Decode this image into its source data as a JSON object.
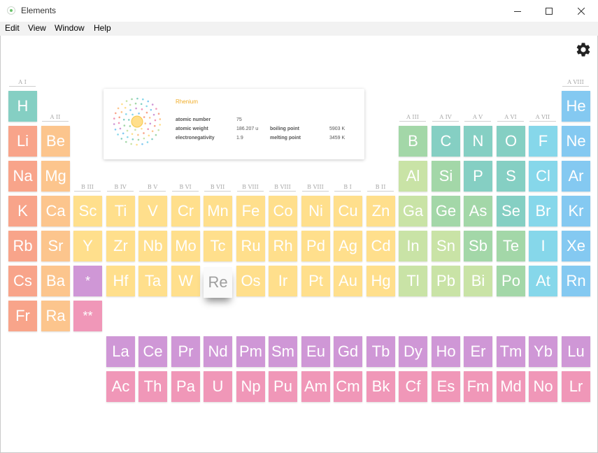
{
  "window": {
    "title": "Elements"
  },
  "menu": [
    "Edit",
    "View",
    "Window",
    "Help"
  ],
  "colors": {
    "alkali": "#f8a48a",
    "alkaline": "#fcc58d",
    "transition": "#ffdf8c",
    "post": "#c9e3a6",
    "metalloid": "#a3d7a8",
    "nonmetal": "#85cfc3",
    "halogen": "#86d7ea",
    "noble": "#84c9f1",
    "lanthanide": "#cf97d6",
    "actinide": "#f097b8",
    "accent": "#f0ad28",
    "highlight": "#cf97d6"
  },
  "groups": [
    "A I",
    "A II",
    "B III",
    "B IV",
    "B V",
    "B VI",
    "B VII",
    "B VIII",
    "B VIII",
    "B VIII",
    "B I",
    "B II",
    "A III",
    "A IV",
    "A V",
    "A VI",
    "A VII",
    "A VIII"
  ],
  "info": {
    "name": "Rhenium",
    "atomic_number_label": "atomic number",
    "atomic_number": "75",
    "atomic_weight_label": "atomic weight",
    "atomic_weight": "186.207 u",
    "electronegativity_label": "electronegativity",
    "electronegativity": "1.9",
    "boiling_point_label": "boiling point",
    "boiling_point": "5903 K",
    "melting_point_label": "melting point",
    "melting_point": "3459 K"
  },
  "hovered": "Re",
  "elements": [
    {
      "s": "H",
      "c": "nonmetal",
      "r": 0,
      "col": 0
    },
    {
      "s": "He",
      "c": "noble",
      "r": 0,
      "col": 17
    },
    {
      "s": "Li",
      "c": "alkali",
      "r": 1,
      "col": 0
    },
    {
      "s": "Be",
      "c": "alkaline",
      "r": 1,
      "col": 1
    },
    {
      "s": "B",
      "c": "metalloid",
      "r": 1,
      "col": 12
    },
    {
      "s": "C",
      "c": "nonmetal",
      "r": 1,
      "col": 13
    },
    {
      "s": "N",
      "c": "nonmetal",
      "r": 1,
      "col": 14
    },
    {
      "s": "O",
      "c": "nonmetal",
      "r": 1,
      "col": 15
    },
    {
      "s": "F",
      "c": "halogen",
      "r": 1,
      "col": 16
    },
    {
      "s": "Ne",
      "c": "noble",
      "r": 1,
      "col": 17
    },
    {
      "s": "Na",
      "c": "alkali",
      "r": 2,
      "col": 0
    },
    {
      "s": "Mg",
      "c": "alkaline",
      "r": 2,
      "col": 1
    },
    {
      "s": "Al",
      "c": "post",
      "r": 2,
      "col": 12
    },
    {
      "s": "Si",
      "c": "metalloid",
      "r": 2,
      "col": 13
    },
    {
      "s": "P",
      "c": "nonmetal",
      "r": 2,
      "col": 14
    },
    {
      "s": "S",
      "c": "nonmetal",
      "r": 2,
      "col": 15
    },
    {
      "s": "Cl",
      "c": "halogen",
      "r": 2,
      "col": 16
    },
    {
      "s": "Ar",
      "c": "noble",
      "r": 2,
      "col": 17
    },
    {
      "s": "K",
      "c": "alkali",
      "r": 3,
      "col": 0
    },
    {
      "s": "Ca",
      "c": "alkaline",
      "r": 3,
      "col": 1
    },
    {
      "s": "Sc",
      "c": "transition",
      "r": 3,
      "col": 2
    },
    {
      "s": "Ti",
      "c": "transition",
      "r": 3,
      "col": 3
    },
    {
      "s": "V",
      "c": "transition",
      "r": 3,
      "col": 4
    },
    {
      "s": "Cr",
      "c": "transition",
      "r": 3,
      "col": 5
    },
    {
      "s": "Mn",
      "c": "transition",
      "r": 3,
      "col": 6
    },
    {
      "s": "Fe",
      "c": "transition",
      "r": 3,
      "col": 7
    },
    {
      "s": "Co",
      "c": "transition",
      "r": 3,
      "col": 8
    },
    {
      "s": "Ni",
      "c": "transition",
      "r": 3,
      "col": 9
    },
    {
      "s": "Cu",
      "c": "transition",
      "r": 3,
      "col": 10
    },
    {
      "s": "Zn",
      "c": "transition",
      "r": 3,
      "col": 11
    },
    {
      "s": "Ga",
      "c": "post",
      "r": 3,
      "col": 12
    },
    {
      "s": "Ge",
      "c": "metalloid",
      "r": 3,
      "col": 13
    },
    {
      "s": "As",
      "c": "metalloid",
      "r": 3,
      "col": 14
    },
    {
      "s": "Se",
      "c": "nonmetal",
      "r": 3,
      "col": 15
    },
    {
      "s": "Br",
      "c": "halogen",
      "r": 3,
      "col": 16
    },
    {
      "s": "Kr",
      "c": "noble",
      "r": 3,
      "col": 17
    },
    {
      "s": "Rb",
      "c": "alkali",
      "r": 4,
      "col": 0
    },
    {
      "s": "Sr",
      "c": "alkaline",
      "r": 4,
      "col": 1
    },
    {
      "s": "Y",
      "c": "transition",
      "r": 4,
      "col": 2
    },
    {
      "s": "Zr",
      "c": "transition",
      "r": 4,
      "col": 3
    },
    {
      "s": "Nb",
      "c": "transition",
      "r": 4,
      "col": 4
    },
    {
      "s": "Mo",
      "c": "transition",
      "r": 4,
      "col": 5
    },
    {
      "s": "Tc",
      "c": "transition",
      "r": 4,
      "col": 6
    },
    {
      "s": "Ru",
      "c": "transition",
      "r": 4,
      "col": 7
    },
    {
      "s": "Rh",
      "c": "transition",
      "r": 4,
      "col": 8
    },
    {
      "s": "Pd",
      "c": "transition",
      "r": 4,
      "col": 9
    },
    {
      "s": "Ag",
      "c": "transition",
      "r": 4,
      "col": 10
    },
    {
      "s": "Cd",
      "c": "transition",
      "r": 4,
      "col": 11
    },
    {
      "s": "In",
      "c": "post",
      "r": 4,
      "col": 12
    },
    {
      "s": "Sn",
      "c": "post",
      "r": 4,
      "col": 13
    },
    {
      "s": "Sb",
      "c": "metalloid",
      "r": 4,
      "col": 14
    },
    {
      "s": "Te",
      "c": "metalloid",
      "r": 4,
      "col": 15
    },
    {
      "s": "I",
      "c": "halogen",
      "r": 4,
      "col": 16
    },
    {
      "s": "Xe",
      "c": "noble",
      "r": 4,
      "col": 17
    },
    {
      "s": "Cs",
      "c": "alkali",
      "r": 5,
      "col": 0
    },
    {
      "s": "Ba",
      "c": "alkaline",
      "r": 5,
      "col": 1
    },
    {
      "s": "*",
      "c": "highlight",
      "r": 5,
      "col": 2
    },
    {
      "s": "Hf",
      "c": "transition",
      "r": 5,
      "col": 3
    },
    {
      "s": "Ta",
      "c": "transition",
      "r": 5,
      "col": 4
    },
    {
      "s": "W",
      "c": "transition",
      "r": 5,
      "col": 5
    },
    {
      "s": "Re",
      "c": "transition",
      "r": 5,
      "col": 6
    },
    {
      "s": "Os",
      "c": "transition",
      "r": 5,
      "col": 7
    },
    {
      "s": "Ir",
      "c": "transition",
      "r": 5,
      "col": 8
    },
    {
      "s": "Pt",
      "c": "transition",
      "r": 5,
      "col": 9
    },
    {
      "s": "Au",
      "c": "transition",
      "r": 5,
      "col": 10
    },
    {
      "s": "Hg",
      "c": "transition",
      "r": 5,
      "col": 11
    },
    {
      "s": "Tl",
      "c": "post",
      "r": 5,
      "col": 12
    },
    {
      "s": "Pb",
      "c": "post",
      "r": 5,
      "col": 13
    },
    {
      "s": "Bi",
      "c": "post",
      "r": 5,
      "col": 14
    },
    {
      "s": "Po",
      "c": "metalloid",
      "r": 5,
      "col": 15
    },
    {
      "s": "At",
      "c": "halogen",
      "r": 5,
      "col": 16
    },
    {
      "s": "Rn",
      "c": "noble",
      "r": 5,
      "col": 17
    },
    {
      "s": "Fr",
      "c": "alkali",
      "r": 6,
      "col": 0
    },
    {
      "s": "Ra",
      "c": "alkaline",
      "r": 6,
      "col": 1
    },
    {
      "s": "**",
      "c": "actinide",
      "r": 6,
      "col": 2
    },
    {
      "s": "La",
      "c": "lanthanide",
      "r": 7,
      "col": 3
    },
    {
      "s": "Ce",
      "c": "lanthanide",
      "r": 7,
      "col": 4
    },
    {
      "s": "Pr",
      "c": "lanthanide",
      "r": 7,
      "col": 5
    },
    {
      "s": "Nd",
      "c": "lanthanide",
      "r": 7,
      "col": 6
    },
    {
      "s": "Pm",
      "c": "lanthanide",
      "r": 7,
      "col": 7
    },
    {
      "s": "Sm",
      "c": "lanthanide",
      "r": 7,
      "col": 8
    },
    {
      "s": "Eu",
      "c": "lanthanide",
      "r": 7,
      "col": 9
    },
    {
      "s": "Gd",
      "c": "lanthanide",
      "r": 7,
      "col": 10
    },
    {
      "s": "Tb",
      "c": "lanthanide",
      "r": 7,
      "col": 11
    },
    {
      "s": "Dy",
      "c": "lanthanide",
      "r": 7,
      "col": 12
    },
    {
      "s": "Ho",
      "c": "lanthanide",
      "r": 7,
      "col": 13
    },
    {
      "s": "Er",
      "c": "lanthanide",
      "r": 7,
      "col": 14
    },
    {
      "s": "Tm",
      "c": "lanthanide",
      "r": 7,
      "col": 15
    },
    {
      "s": "Yb",
      "c": "lanthanide",
      "r": 7,
      "col": 16
    },
    {
      "s": "Lu",
      "c": "lanthanide",
      "r": 7,
      "col": 17
    },
    {
      "s": "Ac",
      "c": "actinide",
      "r": 8,
      "col": 3
    },
    {
      "s": "Th",
      "c": "actinide",
      "r": 8,
      "col": 4
    },
    {
      "s": "Pa",
      "c": "actinide",
      "r": 8,
      "col": 5
    },
    {
      "s": "U",
      "c": "actinide",
      "r": 8,
      "col": 6
    },
    {
      "s": "Np",
      "c": "actinide",
      "r": 8,
      "col": 7
    },
    {
      "s": "Pu",
      "c": "actinide",
      "r": 8,
      "col": 8
    },
    {
      "s": "Am",
      "c": "actinide",
      "r": 8,
      "col": 9
    },
    {
      "s": "Cm",
      "c": "actinide",
      "r": 8,
      "col": 10
    },
    {
      "s": "Bk",
      "c": "actinide",
      "r": 8,
      "col": 11
    },
    {
      "s": "Cf",
      "c": "actinide",
      "r": 8,
      "col": 12
    },
    {
      "s": "Es",
      "c": "actinide",
      "r": 8,
      "col": 13
    },
    {
      "s": "Fm",
      "c": "actinide",
      "r": 8,
      "col": 14
    },
    {
      "s": "Md",
      "c": "actinide",
      "r": 8,
      "col": 15
    },
    {
      "s": "No",
      "c": "actinide",
      "r": 8,
      "col": 16
    },
    {
      "s": "Lr",
      "c": "actinide",
      "r": 8,
      "col": 17
    }
  ]
}
